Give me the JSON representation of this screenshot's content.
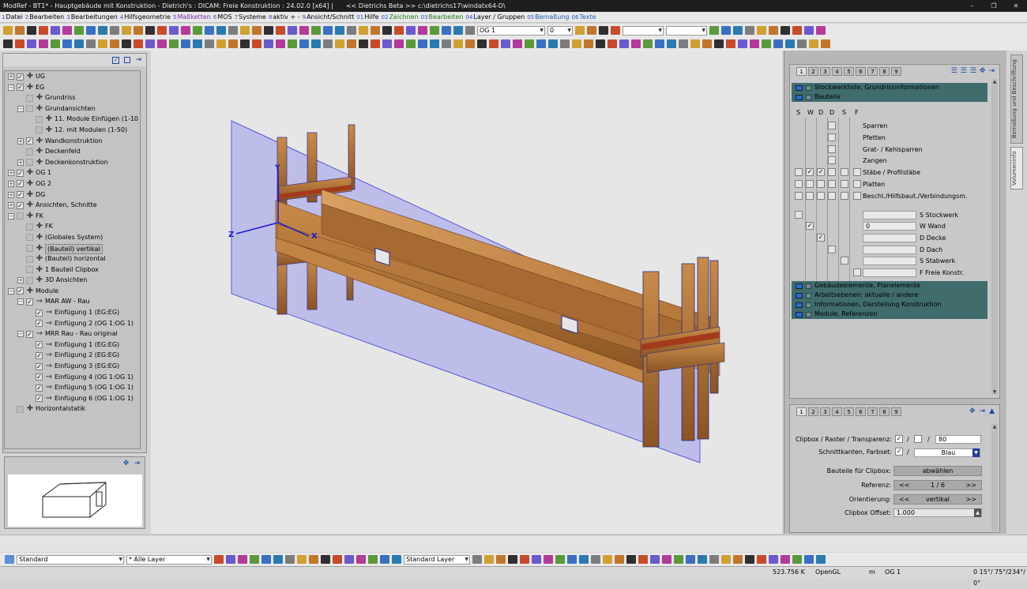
{
  "window": {
    "title": "ModRef - BT1* - Hauptgebäude mit Konstruktion - Dietrich's : DICAM: Freie Konstruktion : 24.02.0 [x64] |",
    "beta": "<< Dietrichs Beta >> c:\\dietrichs17\\windatx64-D\\"
  },
  "menu": [
    {
      "n": "1",
      "l": "Datei",
      "c": "#000"
    },
    {
      "n": "2",
      "l": "Bearbeiten",
      "c": "#000"
    },
    {
      "n": "3",
      "l": "Bearbeitungen",
      "c": "#000"
    },
    {
      "n": "4",
      "l": "Hilfsgeometrie",
      "c": "#000"
    },
    {
      "n": "5",
      "l": "Maßketten",
      "c": "#7a2fb0"
    },
    {
      "n": "6",
      "l": "MOS",
      "c": "#000"
    },
    {
      "n": "7",
      "l": "Systeme",
      "c": "#000"
    },
    {
      "n": "8",
      "l": "aktiv + -",
      "c": "#000"
    },
    {
      "n": "9",
      "l": "Ansicht/Schnitt",
      "c": "#000"
    },
    {
      "n": "01",
      "l": "Hilfe",
      "c": "#000"
    },
    {
      "n": "02",
      "l": "Zeichnen",
      "c": "#1e7e1e"
    },
    {
      "n": "03",
      "l": "Bearbeiten",
      "c": "#1e7e1e"
    },
    {
      "n": "04",
      "l": "Layer / Gruppen",
      "c": "#000"
    },
    {
      "n": "05",
      "l": "Bemaßung",
      "c": "#1e5fc0"
    },
    {
      "n": "06",
      "l": "Texte",
      "c": "#1e5fc0"
    }
  ],
  "toolbar": {
    "storey": "OG 1",
    "storey_value": "0"
  },
  "tree": {
    "header_icons": [
      "checkbox-icon",
      "square-icon",
      "pin-icon"
    ],
    "items": [
      {
        "label": "UG",
        "lvl": 0,
        "exp": "+",
        "cb": true,
        "chk": true
      },
      {
        "label": "EG",
        "lvl": 0,
        "exp": "−",
        "cb": true,
        "chk": true
      },
      {
        "label": "Grundriss",
        "lvl": 1,
        "exp": "",
        "cb": false,
        "chk": false
      },
      {
        "label": "Grundansichten",
        "lvl": 1,
        "exp": "−",
        "cb": false,
        "chk": false
      },
      {
        "label": "11. Module Einfügen (1-10",
        "lvl": 2,
        "exp": "",
        "cb": false,
        "chk": false
      },
      {
        "label": "12. mit Modulen (1-50)",
        "lvl": 2,
        "exp": "",
        "cb": false,
        "chk": false
      },
      {
        "label": "Wandkonstruktion",
        "lvl": 1,
        "exp": "+",
        "cb": true,
        "chk": true
      },
      {
        "label": "Deckenfeld",
        "lvl": 1,
        "exp": "",
        "cb": false,
        "chk": false
      },
      {
        "label": "Deckenkonstruktion",
        "lvl": 1,
        "exp": "+",
        "cb": false,
        "chk": false
      },
      {
        "label": "OG 1",
        "lvl": 0,
        "exp": "+",
        "cb": true,
        "chk": true
      },
      {
        "label": "OG 2",
        "lvl": 0,
        "exp": "+",
        "cb": true,
        "chk": true
      },
      {
        "label": "DG",
        "lvl": 0,
        "exp": "+",
        "cb": true,
        "chk": true
      },
      {
        "label": "Ansichten, Schnitte",
        "lvl": 0,
        "exp": "+",
        "cb": true,
        "chk": true
      },
      {
        "label": "FK",
        "lvl": 0,
        "exp": "−",
        "cb": false,
        "chk": false
      },
      {
        "label": "FK",
        "lvl": 1,
        "exp": "",
        "cb": false,
        "chk": false
      },
      {
        "label": "(Globales System)",
        "lvl": 1,
        "exp": "",
        "cb": false,
        "chk": false
      },
      {
        "label": "(Bauteil) vertikal",
        "lvl": 1,
        "exp": "",
        "cb": false,
        "chk": false,
        "sel": true
      },
      {
        "label": "(Bauteil) horizontal",
        "lvl": 1,
        "exp": "",
        "cb": false,
        "chk": false
      },
      {
        "label": "1 Bauteil Clipbox",
        "lvl": 1,
        "exp": "",
        "cb": false,
        "chk": false
      },
      {
        "label": "3D Ansichten",
        "lvl": 1,
        "exp": "+",
        "cb": false,
        "chk": false
      },
      {
        "label": "Module",
        "lvl": 0,
        "exp": "−",
        "cb": true,
        "chk": true
      },
      {
        "label": "MAR AW - Rau",
        "lvl": 1,
        "exp": "−",
        "cb": true,
        "chk": true,
        "mod": true
      },
      {
        "label": "Einfügung 1 (EG:EG)",
        "lvl": 2,
        "exp": "",
        "cb": true,
        "chk": true,
        "mod": true
      },
      {
        "label": "Einfügung 2 (OG 1:OG 1)",
        "lvl": 2,
        "exp": "",
        "cb": true,
        "chk": true,
        "mod": true
      },
      {
        "label": "MRR Rau - Rau original",
        "lvl": 1,
        "exp": "−",
        "cb": true,
        "chk": true,
        "mod": true
      },
      {
        "label": "Einfügung 1 (EG:EG)",
        "lvl": 2,
        "exp": "",
        "cb": true,
        "chk": true,
        "mod": true
      },
      {
        "label": "Einfügung 2 (EG:EG)",
        "lvl": 2,
        "exp": "",
        "cb": true,
        "chk": true,
        "mod": true
      },
      {
        "label": "Einfügung 3 (EG:EG)",
        "lvl": 2,
        "exp": "",
        "cb": true,
        "chk": true,
        "mod": true
      },
      {
        "label": "Einfügung 4 (OG 1:OG 1)",
        "lvl": 2,
        "exp": "",
        "cb": true,
        "chk": true,
        "mod": true
      },
      {
        "label": "Einfügung 5 (OG 1:OG 1)",
        "lvl": 2,
        "exp": "",
        "cb": true,
        "chk": true,
        "mod": true
      },
      {
        "label": "Einfügung 6 (OG 1:OG 1)",
        "lvl": 2,
        "exp": "",
        "cb": true,
        "chk": true,
        "mod": true
      },
      {
        "label": "Horizontalstatik",
        "lvl": 0,
        "exp": "",
        "cb": false,
        "chk": false
      }
    ]
  },
  "viewport": {
    "axis_x": "X",
    "axis_y": "Y",
    "axis_z": "Z"
  },
  "right_panel": {
    "tabs": [
      "1",
      "2",
      "3",
      "4",
      "5",
      "6",
      "7",
      "8",
      "9"
    ],
    "sections_top": [
      "Stockwerkliste, Grundrissinformationen",
      "Bauteile"
    ],
    "columns": [
      "S",
      "W",
      "D",
      "D",
      "S",
      "F"
    ],
    "bauteile": [
      "Sparren",
      "Pfetten",
      "Grat- / Kehlsparren",
      "Zangen",
      "Stäbe / Profilstäbe",
      "Platten",
      "Beschl./Hilfsbaut./Verbindungsm."
    ],
    "fields": [
      {
        "label": "S Stockwerk",
        "value": ""
      },
      {
        "label": "W Wand",
        "value": "0"
      },
      {
        "label": "D Decke",
        "value": ""
      },
      {
        "label": "D Dach",
        "value": ""
      },
      {
        "label": "S Stabwerk",
        "value": ""
      },
      {
        "label": "F Freie Konstr.",
        "value": ""
      }
    ],
    "sections_bottom": [
      "Gebäudeelemente, Planelemente",
      "Arbeitsebenen: aktuelle / andere",
      "Informationen, Darstellung Konstruktion",
      "Module, Referenzen"
    ]
  },
  "clip_panel": {
    "tabs": [
      "1",
      "2",
      "3",
      "4",
      "5",
      "6",
      "7",
      "8",
      "9"
    ],
    "clipbox_label": "Clipbox / Raster / Transparenz:",
    "transparency": "80",
    "schnitt_label": "Schnittkanten, Farbset:",
    "farbset": "Blau",
    "bauteile_label": "Bauteile für Clipbox:",
    "abwaehlen": "abwählen",
    "referenz_label": "Referenz:",
    "referenz_value": "1 / 6",
    "orient_label": "Orientierung:",
    "orient_value": "vertikal",
    "offset_label": "Clipbox Offset:",
    "offset_value": "1.000",
    "prev": "<<",
    "next": ">>"
  },
  "side_tabs": [
    "Bemaßung und Beschriftung",
    "Volumeninfo"
  ],
  "bottom_toolbar": {
    "style": "Standard",
    "layer": "* Alle Layer",
    "std_layer": "Standard Layer"
  },
  "status": {
    "coord": "523.756 K",
    "renderer": "OpenGL",
    "unit": "m",
    "storey": "OG 1",
    "angles": "0 15°/ 75°/234°/ 0°"
  }
}
